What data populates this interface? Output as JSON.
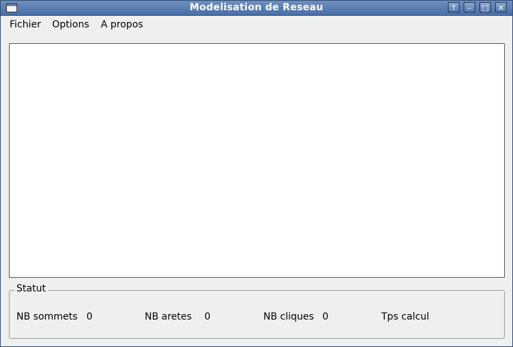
{
  "window": {
    "title": "Modelisation de Reseau",
    "buttons": {
      "shade": "↑",
      "minimize": "–",
      "maximize": "□",
      "close": "✕"
    }
  },
  "menu": {
    "items": [
      {
        "label": "Fichier"
      },
      {
        "label": "Options"
      },
      {
        "label": "A propos"
      }
    ]
  },
  "status": {
    "title": "Statut",
    "nb_sommets": {
      "label": "NB sommets",
      "value": "0"
    },
    "nb_aretes": {
      "label": "NB aretes",
      "value": "0"
    },
    "nb_cliques": {
      "label": "NB cliques",
      "value": "0"
    },
    "tps_calcul": {
      "label": "Tps calcul",
      "value": ""
    }
  },
  "colors": {
    "titlebar": "#4a6ea6",
    "background": "#efefef",
    "canvas": "#ffffff"
  }
}
